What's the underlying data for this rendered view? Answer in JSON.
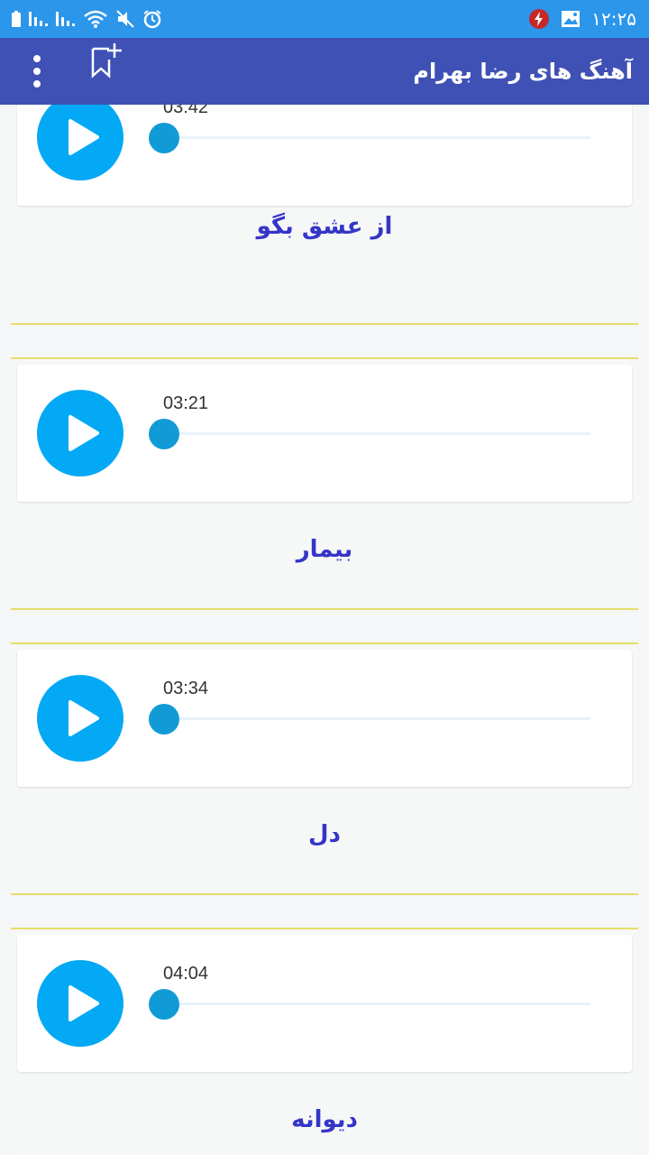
{
  "status_bar": {
    "time": "۱۲:۲۵",
    "icons": [
      "battery-icon",
      "signal-icon",
      "signal-icon",
      "wifi-icon",
      "mute-icon",
      "alarm-icon",
      "lightning-icon",
      "image-icon"
    ]
  },
  "toolbar": {
    "title": "آهنگ های رضا بهرام",
    "menu_icon": "more-vert-icon",
    "bookmark_icon": "bookmark-add-icon"
  },
  "songs": [
    {
      "duration": "03:42",
      "title": "از عشق بگو",
      "progress": 0
    },
    {
      "duration": "03:21",
      "title": "بیمار",
      "progress": 0
    },
    {
      "duration": "03:34",
      "title": "دل",
      "progress": 0
    },
    {
      "duration": "04:04",
      "title": "دیوانه",
      "progress": 0
    }
  ],
  "colors": {
    "status_bar": "#2c96ea",
    "toolbar": "#3f51b5",
    "play_button": "#03a9f4",
    "title_text": "#3535c8",
    "divider": "#e6dd6a"
  }
}
